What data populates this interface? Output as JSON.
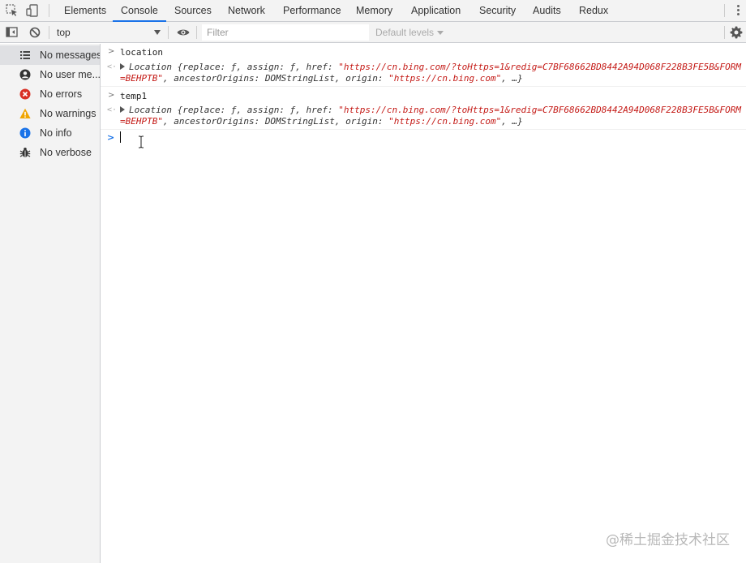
{
  "tabs": [
    "Elements",
    "Console",
    "Sources",
    "Network",
    "Performance",
    "Memory",
    "Application",
    "Security",
    "Audits",
    "Redux"
  ],
  "active_tab": "Console",
  "toolbar": {
    "context": "top",
    "filter_placeholder": "Filter",
    "levels": "Default levels"
  },
  "sidebar": {
    "items": [
      {
        "label": "No messages",
        "icon": "list-icon"
      },
      {
        "label": "No user me...",
        "icon": "user-icon"
      },
      {
        "label": "No errors",
        "icon": "error-icon"
      },
      {
        "label": "No warnings",
        "icon": "warning-icon"
      },
      {
        "label": "No info",
        "icon": "info-icon"
      },
      {
        "label": "No verbose",
        "icon": "bug-icon"
      }
    ]
  },
  "console": {
    "entries": [
      {
        "input": "location",
        "result_prefix": "Location {replace: ƒ, assign: ƒ, href: ",
        "result_href": "\"https://cn.bing.com/?toHttps=1&redig=C7BF68662BD8442A94D068F228B3FE5B&FORM=BEHPTB\"",
        "result_mid": ", ancestorOrigins: DOMStringList, origin: ",
        "result_origin": "\"https://cn.bing.com\"",
        "result_suffix": ", …}"
      },
      {
        "input": "temp1",
        "result_prefix": "Location {replace: ƒ, assign: ƒ, href: ",
        "result_href": "\"https://cn.bing.com/?toHttps=1&redig=C7BF68662BD8442A94D068F228B3FE5B&FORM=BEHPTB\"",
        "result_mid": ", ancestorOrigins: DOMStringList, origin: ",
        "result_origin": "\"https://cn.bing.com\"",
        "result_suffix": ", …}"
      }
    ]
  },
  "watermark": "@稀土掘金技术社区",
  "colors": {
    "accent": "#1a73e8",
    "string": "#c41a16",
    "error": "#d93025",
    "warning": "#f0a500",
    "info": "#1a73e8"
  }
}
